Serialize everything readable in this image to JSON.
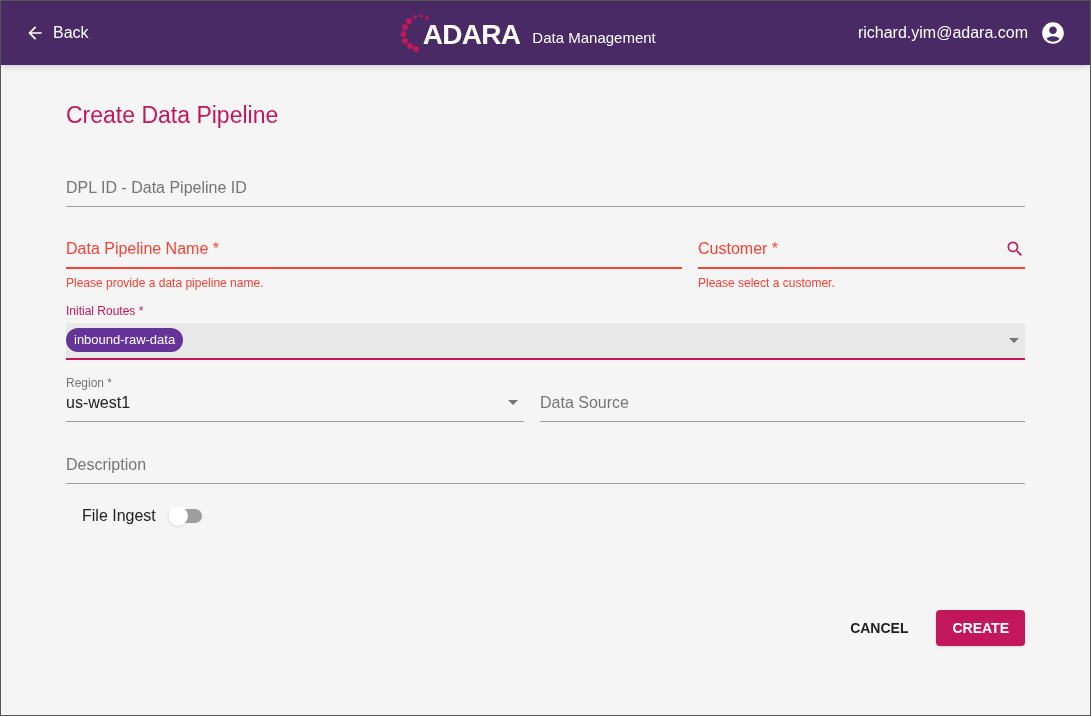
{
  "header": {
    "back": "Back",
    "logo": "ADARA",
    "product": "Data Management",
    "user": "richard.yim@adara.com"
  },
  "title": "Create Data Pipeline",
  "fields": [
    {
      "kind": "text",
      "label": "DPL ID - Data Pipeline ID",
      "error": false
    },
    {
      "kind": "row",
      "items": [
        {
          "kind": "text",
          "label": "Data Pipeline Name *",
          "error": true,
          "helper": "Please provide a data pipeline name."
        },
        {
          "kind": "search",
          "label": "Customer *",
          "error": true,
          "helper": "Please select a customer."
        }
      ]
    },
    {
      "kind": "chips",
      "label": "Initial Routes *",
      "focused": true,
      "chips": [
        "inbound-raw-data"
      ]
    },
    {
      "kind": "row",
      "items": [
        {
          "kind": "select",
          "label": "Region *",
          "error": false,
          "value": "us-west1"
        },
        {
          "kind": "text",
          "label": "Data Source",
          "error": false
        }
      ]
    },
    {
      "kind": "text",
      "label": "Description",
      "error": false
    }
  ],
  "toggle": {
    "label": "File Ingest",
    "on": false
  },
  "buttons": [
    {
      "label": "CANCEL",
      "kind": "text"
    },
    {
      "label": "CREATE",
      "kind": "primary"
    }
  ]
}
